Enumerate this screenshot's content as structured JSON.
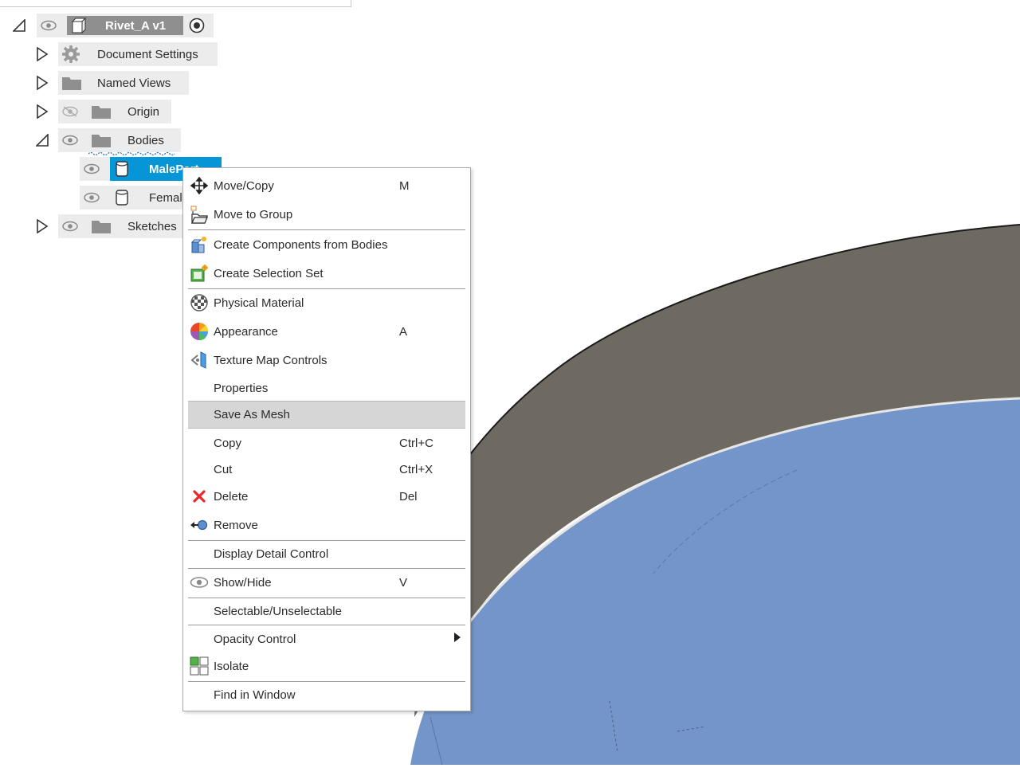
{
  "browser": {
    "root": {
      "label": "Rivet_A v1"
    },
    "items": [
      {
        "label": "Document Settings"
      },
      {
        "label": "Named Views"
      },
      {
        "label": "Origin"
      },
      {
        "label": "Bodies"
      },
      {
        "label": "MalePart",
        "selected": true
      },
      {
        "label": "Femal"
      },
      {
        "label": "Sketches"
      }
    ]
  },
  "context_menu": {
    "items": [
      {
        "label": "Move/Copy",
        "shortcut": "M",
        "icon": "move-icon"
      },
      {
        "label": "Move to Group",
        "shortcut": "",
        "icon": "move-to-group-icon"
      },
      {
        "label": "Create Components from Bodies",
        "shortcut": "",
        "icon": "create-components-icon"
      },
      {
        "label": "Create Selection Set",
        "shortcut": "",
        "icon": "selection-set-icon"
      },
      {
        "label": "Physical Material",
        "shortcut": "",
        "icon": "material-icon"
      },
      {
        "label": "Appearance",
        "shortcut": "A",
        "icon": "appearance-icon"
      },
      {
        "label": "Texture Map Controls",
        "shortcut": "",
        "icon": "texture-map-icon"
      },
      {
        "label": "Properties",
        "shortcut": "",
        "icon": ""
      },
      {
        "label": "Save As Mesh",
        "shortcut": "",
        "icon": "",
        "highlighted": true
      },
      {
        "label": "Copy",
        "shortcut": "Ctrl+C",
        "icon": ""
      },
      {
        "label": "Cut",
        "shortcut": "Ctrl+X",
        "icon": ""
      },
      {
        "label": "Delete",
        "shortcut": "Del",
        "icon": "delete-icon"
      },
      {
        "label": "Remove",
        "shortcut": "",
        "icon": "remove-icon"
      },
      {
        "label": "Display Detail Control",
        "shortcut": "",
        "icon": ""
      },
      {
        "label": "Show/Hide",
        "shortcut": "V",
        "icon": "eye-icon"
      },
      {
        "label": "Selectable/Unselectable",
        "shortcut": "",
        "icon": ""
      },
      {
        "label": "Opacity Control",
        "shortcut": "",
        "icon": "",
        "submenu": true
      },
      {
        "label": "Isolate",
        "shortcut": "",
        "icon": "isolate-icon"
      },
      {
        "label": "Find in Window",
        "shortcut": "",
        "icon": ""
      }
    ]
  },
  "colors": {
    "selection_blue": "#0696d7",
    "highlight_gray": "#d6d6d6",
    "model_top_blue": "#7395c9",
    "model_side_gray": "#6e6a62",
    "delete_red": "#e8282b"
  }
}
